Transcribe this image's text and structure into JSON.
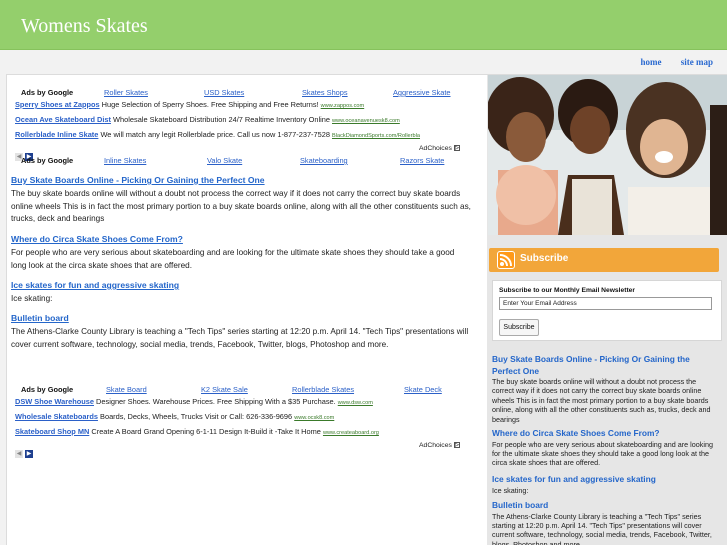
{
  "header": {
    "title": "Womens Skates"
  },
  "nav": {
    "home": "home",
    "site_map": "site map"
  },
  "ads_top": {
    "label": "Ads by Google",
    "links": [
      "Roller Skates",
      "USD Skates",
      "Skates Shops",
      "Aggressive Skate"
    ],
    "items": [
      {
        "title": "Sperry Shoes at Zappos",
        "text": "Huge Selection of Sperry Shoes. Free Shipping and Free Returns!",
        "url": "www.zappos.com"
      },
      {
        "title": "Ocean Ave Skateboard Dist",
        "text": "Wholesale Skateboard Distribution 24/7 Realtime Inventory Online",
        "url": "www.oceanavenuesk8.com"
      },
      {
        "title": "Rollerblade Inline Skate",
        "text": "We will match any legit Rollerblade price. Call us now 1-877-237-7528",
        "url": "BlackDiamondSports.com/Rollerbla"
      }
    ],
    "adchoices": "AdChoices"
  },
  "ads_mid": {
    "label": "Ads by Google",
    "links": [
      "Inline Skates",
      "Valo Skate",
      "Skateboarding",
      "Razors Skate"
    ]
  },
  "articles": [
    {
      "title": "Buy Skate Boards Online - Picking Or Gaining the Perfect One",
      "body": "The buy skate boards online will without a doubt not process the correct way if it does not carry the correct buy skate boards online wheels This is in fact the most primary portion to a buy skate boards online, along with all the other constituents such as, trucks, deck and bearings"
    },
    {
      "title": "Where do Circa Skate Shoes Come From?",
      "body": "For people who are very serious about skateboarding and are looking for the ultimate skate shoes they should take a good long look at the circa skate shoes that are offered."
    },
    {
      "title": "Ice skates for fun and aggressive skating",
      "body": "Ice skating:"
    },
    {
      "title": "Bulletin board",
      "body": "The Athens-Clarke County Library is teaching a \"Tech Tips\" series starting at 12:20 p.m. April 14. \"Tech Tips\" presentations will cover current software, technology, social media, trends, Facebook, Twitter, blogs, Photoshop and more."
    }
  ],
  "ads_bottom": {
    "label": "Ads by Google",
    "links": [
      "Skate Board",
      "K2 Skate Sale",
      "Rollerblade Skates",
      "Skate Deck"
    ],
    "items": [
      {
        "title": "DSW Shoe Warehouse",
        "text": "Designer Shoes. Warehouse Prices. Free Shipping With a $35 Purchase.",
        "url": "www.dsw.com"
      },
      {
        "title": "Wholesale Skateboards",
        "text": "Boards, Decks, Wheels, Trucks Visit or Call: 626-336-9696",
        "url": "www.ocsk8.com"
      },
      {
        "title": "Skateboard Shop MN",
        "text": "Create A Board Grand Opening 6-1-11 Design It-Build it -Take It Home",
        "url": "www.createaboard.org"
      }
    ],
    "adchoices": "AdChoices"
  },
  "sidebar": {
    "subscribe": "Subscribe",
    "newsletter": {
      "title": "Subscribe to our Monthly Email Newsletter",
      "placeholder": "Enter Your Email Address",
      "button": "Subscribe"
    },
    "articles": [
      {
        "title": "Buy Skate Boards Online - Picking Or Gaining the Perfect One",
        "body": "The buy skate boards online will without a doubt not process the correct way if it does not carry the correct buy skate boards online wheels This is in fact the most primary portion to a buy skate boards online, along with all the other constituents such as, trucks, deck and bearings"
      },
      {
        "title": "Where do Circa Skate Shoes Come From?",
        "body": "For people who are very serious about skateboarding and are looking for the ultimate skate shoes they should take a good long look at the circa skate shoes that are offered."
      },
      {
        "title": "Ice skates for fun and aggressive skating",
        "body": "Ice skating:"
      },
      {
        "title": "Bulletin board",
        "body": "The Athens-Clarke County Library is teaching a \"Tech Tips\" series starting at 12:20 p.m. April 14. \"Tech Tips\" presentations will cover current software, technology, social media, trends, Facebook, Twitter, blogs, Photoshop and more."
      }
    ]
  },
  "colors": {
    "header_bg": "#94cf6c",
    "link": "#2466ca",
    "subscribe_bg": "#f2a63a",
    "ad_url": "#3a7a2a"
  },
  "icons": {
    "rss": "rss-icon",
    "prev": "prev-arrow-icon",
    "next": "next-arrow-icon",
    "adchoices": "adchoices-icon"
  }
}
